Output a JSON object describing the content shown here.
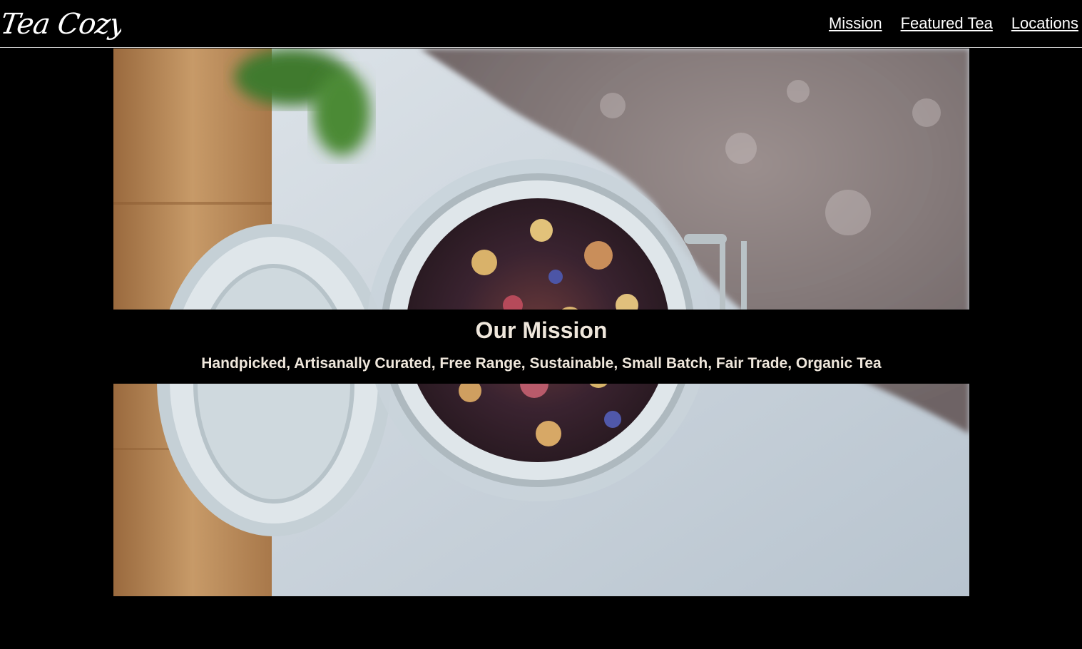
{
  "header": {
    "logo_text": "Tea Cozy",
    "nav": [
      {
        "label": "Mission"
      },
      {
        "label": "Featured Tea"
      },
      {
        "label": "Locations"
      }
    ]
  },
  "mission": {
    "title": "Our Mission",
    "subtitle": "Handpicked, Artisanally Curated, Free Range, Sustainable, Small Batch, Fair Trade, Organic Tea"
  },
  "colors": {
    "background": "#000000",
    "nav_text": "#ffffff",
    "mission_text": "#efe7dc",
    "header_border": "#d9d9d9"
  },
  "hero_image": {
    "subject": "open glass jar of loose leaf fruit tea on a table beside wood board and knit blanket"
  }
}
